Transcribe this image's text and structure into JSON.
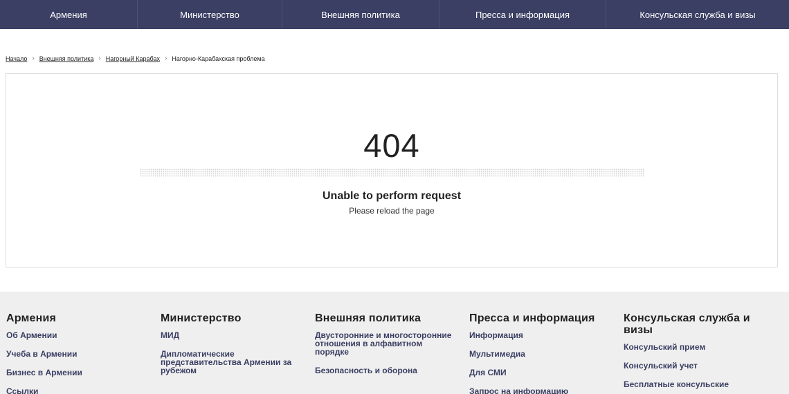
{
  "topnav": {
    "items": [
      {
        "label": "Армения"
      },
      {
        "label": "Министерство"
      },
      {
        "label": "Внешняя политика"
      },
      {
        "label": "Пресса и информация"
      },
      {
        "label": "Консульская служба и визы"
      }
    ]
  },
  "breadcrumb": {
    "home": "Начало",
    "level1": "Внешняя политика",
    "level2": "Нагорный Карабах",
    "current": "Нагорно-Карабахская проблема",
    "separator": "›"
  },
  "error": {
    "code": "404",
    "title": "Unable to perform request",
    "subtitle": "Please reload the page"
  },
  "footer": {
    "columns": [
      {
        "heading": "Армения",
        "links": [
          "Об Армении",
          "Учеба в Армении",
          "Бизнес в Армении",
          "Ссылки"
        ]
      },
      {
        "heading": "Министерство",
        "links": [
          "МИД",
          "Дипломатические представительства Армении за рубежом"
        ]
      },
      {
        "heading": "Внешняя политика",
        "links": [
          "Двусторонние и многосторонние отношения в алфавитном порядке",
          "Безопасность и оборона"
        ]
      },
      {
        "heading": "Пресса и информация",
        "links": [
          "Информация",
          "Мультимедиа",
          "Для СМИ",
          "Запрос на информацию"
        ]
      },
      {
        "heading": "Консульская служба и визы",
        "links": [
          "Консульский прием",
          "Консульский учет",
          "Бесплатные консульские"
        ]
      }
    ]
  },
  "colors": {
    "nav_background": "#3a3f63",
    "footer_background": "#efefef",
    "footer_link": "#3a3f63"
  }
}
